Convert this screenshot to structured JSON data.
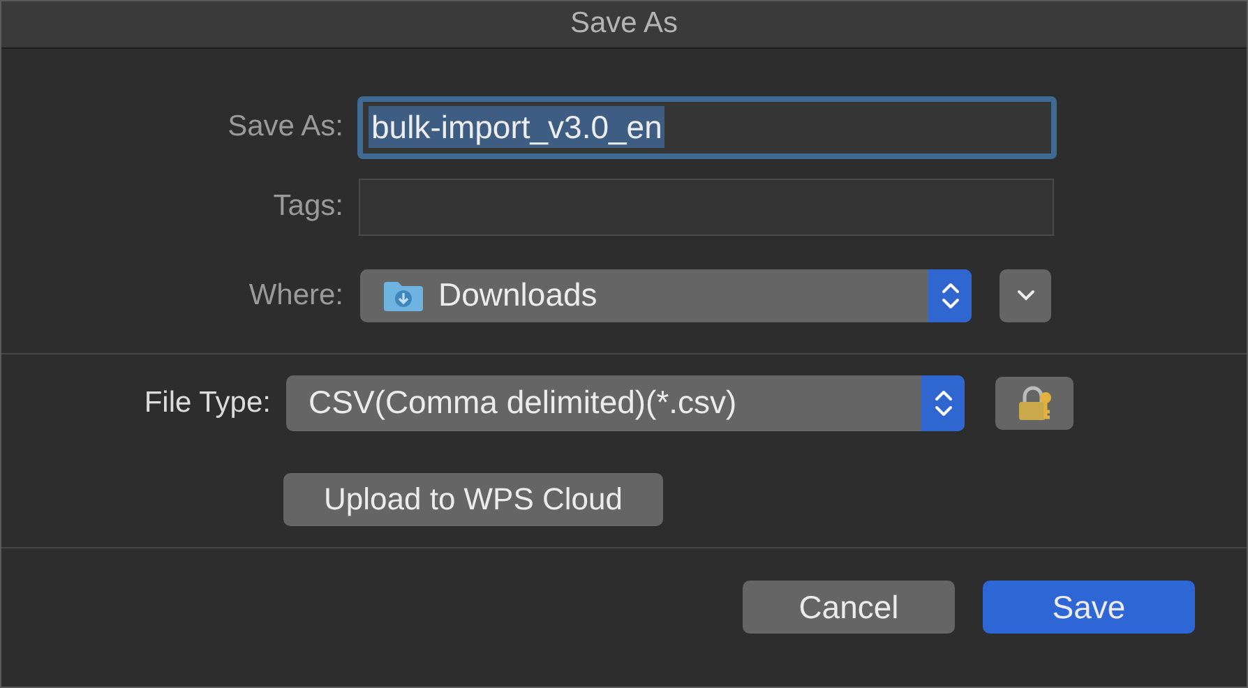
{
  "window": {
    "title": "Save As"
  },
  "save_as": {
    "label": "Save As:",
    "value": "bulk-import_v3.0_en",
    "text_selected": true,
    "focused": true
  },
  "tags": {
    "label": "Tags:"
  },
  "where": {
    "label": "Where:",
    "value": "Downloads"
  },
  "file_type": {
    "label": "File Type:",
    "value": "CSV(Comma delimited)(*.csv)"
  },
  "upload_button": "Upload to WPS Cloud",
  "buttons": [
    {
      "label": "Cancel",
      "kind": "secondary"
    },
    {
      "label": "Save",
      "kind": "primary"
    }
  ]
}
